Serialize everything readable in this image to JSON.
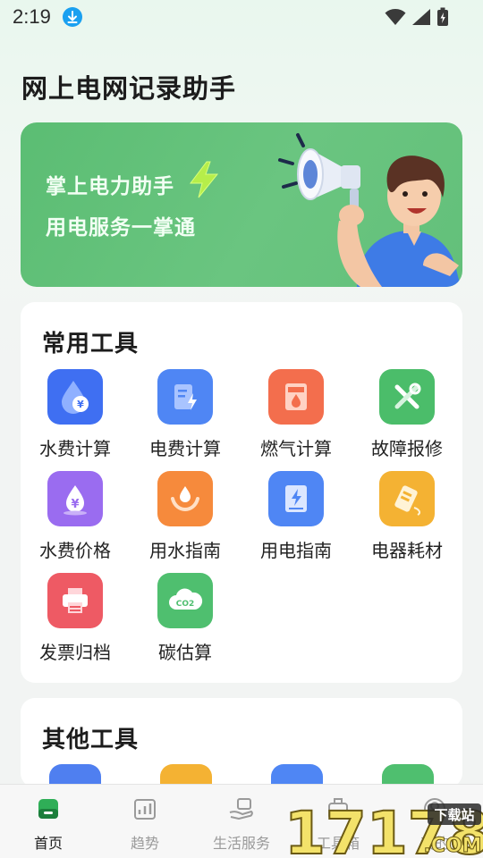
{
  "status_bar": {
    "time": "2:19"
  },
  "page": {
    "title": "网上电网记录助手"
  },
  "banner": {
    "line1": "掌上电力助手",
    "line2": "用电服务一掌通"
  },
  "common_tools": {
    "title": "常用工具",
    "items": [
      {
        "label": "水费计算",
        "icon": "water-drop-yen-icon",
        "color": "#3f6ff2"
      },
      {
        "label": "电费计算",
        "icon": "electric-bill-icon",
        "color": "#4f86f4"
      },
      {
        "label": "燃气计算",
        "icon": "gas-meter-icon",
        "color": "#f36e4d"
      },
      {
        "label": "故障报修",
        "icon": "repair-tools-icon",
        "color": "#4bbd6a"
      },
      {
        "label": "水费价格",
        "icon": "water-price-icon",
        "color": "#9a6cf0"
      },
      {
        "label": "用水指南",
        "icon": "water-guide-icon",
        "color": "#f68a3c"
      },
      {
        "label": "用电指南",
        "icon": "electric-guide-icon",
        "color": "#4f86f4"
      },
      {
        "label": "电器耗材",
        "icon": "appliance-tag-icon",
        "color": "#f4b233"
      },
      {
        "label": "发票归档",
        "icon": "printer-icon",
        "color": "#ee5a64"
      },
      {
        "label": "碳估算",
        "icon": "co2-cloud-icon",
        "color": "#4fbf6f"
      }
    ]
  },
  "other_tools": {
    "title": "其他工具"
  },
  "bottom_nav": {
    "items": [
      {
        "label": "首页",
        "icon": "home-icon",
        "active": true
      },
      {
        "label": "趋势",
        "icon": "trend-chart-icon",
        "active": false
      },
      {
        "label": "生活服务",
        "icon": "hand-service-icon",
        "active": false
      },
      {
        "label": "工具箱",
        "icon": "toolbox-icon",
        "active": false
      },
      {
        "label": "我的",
        "icon": "profile-icon",
        "active": false
      }
    ]
  },
  "watermark": {
    "text": "17178",
    "sub": "下载站",
    "domain": ".COM"
  }
}
